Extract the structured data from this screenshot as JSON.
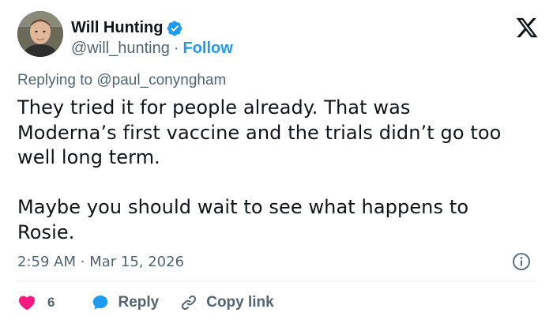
{
  "user": {
    "display_name": "Will Hunting",
    "handle": "@will_hunting",
    "separator": "·",
    "follow_label": "Follow",
    "verified": true
  },
  "colors": {
    "accent": "#1d9bf0",
    "like": "#f91880",
    "text": "#0f1419",
    "muted": "#536471"
  },
  "icons": {
    "brand": "x-logo-icon",
    "verified": "verified-badge-icon",
    "info": "info-icon",
    "like": "heart-icon",
    "reply": "speech-bubble-icon",
    "copy": "link-icon"
  },
  "tweet": {
    "replying_prefix": "Replying to",
    "replying_to": "@paul_conyngham",
    "text": "They tried it for people already. That was\nModerna’s first vaccine and the trials didn’t go too\nwell long term.\n\nMaybe you should wait to see what happens to\nRosie.",
    "time": "2:59 AM",
    "date": "Mar 15, 2026",
    "time_separator": "·"
  },
  "actions": {
    "like_count": "6",
    "reply_label": "Reply",
    "copy_label": "Copy link"
  }
}
